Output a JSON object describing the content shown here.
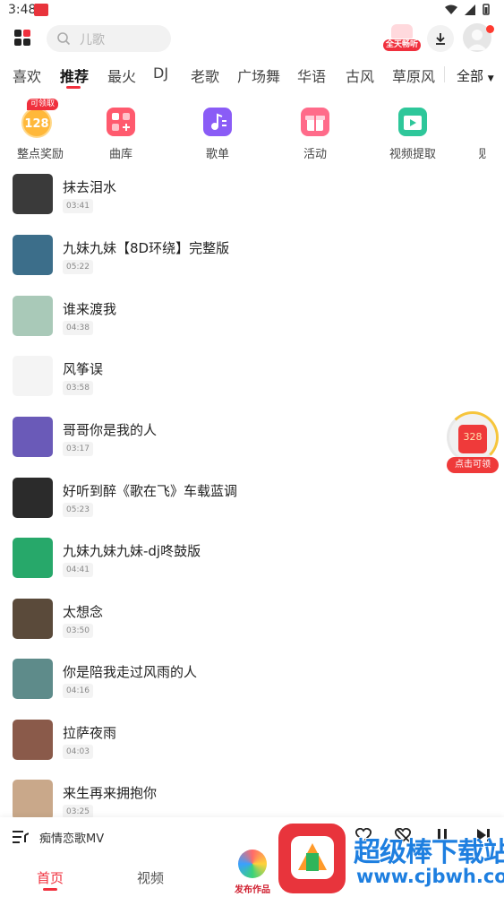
{
  "status_bar": {
    "time": "3:48"
  },
  "header": {
    "search_placeholder": "儿歌",
    "vip_badge": "全天畅听"
  },
  "category_tabs": {
    "items": [
      "喜欢",
      "推荐",
      "最火",
      "DJ",
      "老歌",
      "广场舞",
      "华语",
      "古风",
      "草原风"
    ],
    "active": "推荐",
    "all_label": "全部"
  },
  "quick_entries": {
    "reward": {
      "label": "整点奖励",
      "coins": "128",
      "tag": "可领取"
    },
    "items": [
      {
        "label": "曲库",
        "icon": "library-icon",
        "color": "#ff5a6e"
      },
      {
        "label": "歌单",
        "icon": "playlist-icon",
        "color": "#8a5cf6"
      },
      {
        "label": "活动",
        "icon": "gift-icon",
        "color": "#ff6b8a"
      },
      {
        "label": "视频提取",
        "icon": "video-extract-icon",
        "color": "#2ec79a"
      },
      {
        "label": "视",
        "icon": "partial-icon",
        "color": "#cccccc"
      }
    ]
  },
  "songs": [
    {
      "title": "抹去泪水",
      "duration": "03:41",
      "cover_color": "#3a3a3a"
    },
    {
      "title": "九妹九妹【8D环绕】完整版",
      "duration": "05:22",
      "cover_color": "#3c6e8a"
    },
    {
      "title": "谁来渡我",
      "duration": "04:38",
      "cover_color": "#a9c9b8"
    },
    {
      "title": "风筝误",
      "duration": "03:58",
      "cover_color": "#f4f4f4"
    },
    {
      "title": "哥哥你是我的人",
      "duration": "03:17",
      "cover_color": "#6a5ab8"
    },
    {
      "title": "好听到醉《歌在飞》车载蓝调",
      "duration": "05:23",
      "cover_color": "#2b2b2b"
    },
    {
      "title": "九妹九妹九妹-dj咚鼓版",
      "duration": "04:41",
      "cover_color": "#27a86a"
    },
    {
      "title": "太想念",
      "duration": "03:50",
      "cover_color": "#5a4a3a"
    },
    {
      "title": "你是陪我走过风雨的人",
      "duration": "04:16",
      "cover_color": "#5e8b8a"
    },
    {
      "title": "拉萨夜雨",
      "duration": "04:03",
      "cover_color": "#8a5a4a"
    },
    {
      "title": "来生再来拥抱你",
      "duration": "03:25",
      "cover_color": "#c9a88a"
    }
  ],
  "floating_reward": {
    "amount": "328",
    "label": "点击可领"
  },
  "mini_player": {
    "title": "痴情恋歌MV"
  },
  "bottom_nav": {
    "items": [
      "首页",
      "视频"
    ],
    "active": "首页",
    "publish_label": "发布作品"
  },
  "watermark": {
    "title": "超级棒下载站",
    "url": "www.cjbwh.com"
  }
}
